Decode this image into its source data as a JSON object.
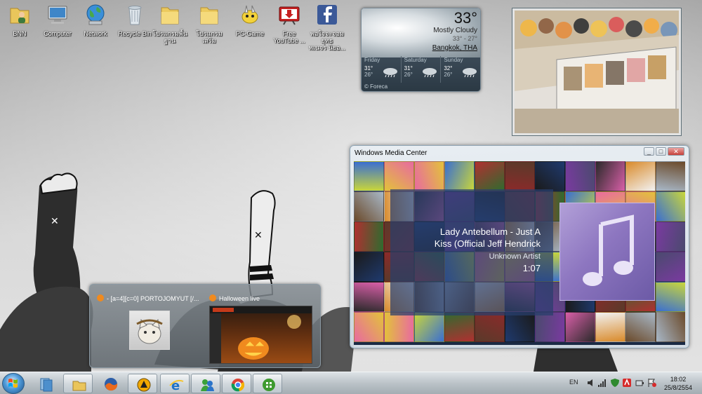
{
  "desktop": {
    "icons": [
      {
        "label": "BNN",
        "icon": "folder-user-icon"
      },
      {
        "label": "Computer",
        "icon": "computer-icon"
      },
      {
        "label": "Network",
        "icon": "network-globe-icon"
      },
      {
        "label": "Recycle Bin",
        "icon": "recycle-bin-icon"
      },
      {
        "label": "โปรแกรมพื้น\nฐาน",
        "icon": "folder-icon"
      },
      {
        "label": "โปรแกรมเสริม",
        "icon": "folder-icon"
      },
      {
        "label": "PC-Game",
        "icon": "game-character-icon"
      },
      {
        "label": "Free\nYouTube ...",
        "icon": "youtube-downloader-icon"
      },
      {
        "label": "พอใจจะจอมยุทธ\nพเนจร นิยอ...",
        "icon": "facebook-icon"
      }
    ]
  },
  "weather": {
    "temperature": "33°",
    "condition": "Mostly Cloudy",
    "range": "33° - 27°",
    "location": "Bangkok, THA",
    "forecast": [
      {
        "day": "Friday",
        "high": "31°",
        "low": "26°"
      },
      {
        "day": "Saturday",
        "high": "31°",
        "low": "26°"
      },
      {
        "day": "Sunday",
        "high": "32°",
        "low": "26°"
      }
    ],
    "provider": "© Foreca"
  },
  "media_center": {
    "title": "Windows Media Center",
    "controls": [
      "_",
      "□",
      "✕"
    ],
    "now_playing": {
      "title_line1": "Lady Antebellum - Just A",
      "title_line2": "Kiss (Official Jeff Hendrick",
      "artist": "Unknown Artist",
      "time": "1:07"
    }
  },
  "thumbnails": {
    "window1_label": "- [a=4][c=0] PORTOJOMYUT [/...",
    "window2_label": "Halloween live"
  },
  "taskbar": {
    "language": "EN",
    "time": "18:02",
    "date": "25/8/2554",
    "buttons": [
      {
        "name": "task-view-icon",
        "active": false
      },
      {
        "name": "explorer-icon",
        "active": true
      },
      {
        "name": "firefox-icon",
        "active": false
      },
      {
        "name": "media-player-icon",
        "active": true
      },
      {
        "name": "internet-explorer-icon",
        "active": true
      },
      {
        "name": "messenger-icon",
        "active": true
      },
      {
        "name": "chrome-icon",
        "active": true
      },
      {
        "name": "media-center-icon",
        "active": true
      }
    ]
  },
  "colors": {
    "accent": "#2b6cb0",
    "album_art_bg": "#8d76c0"
  }
}
